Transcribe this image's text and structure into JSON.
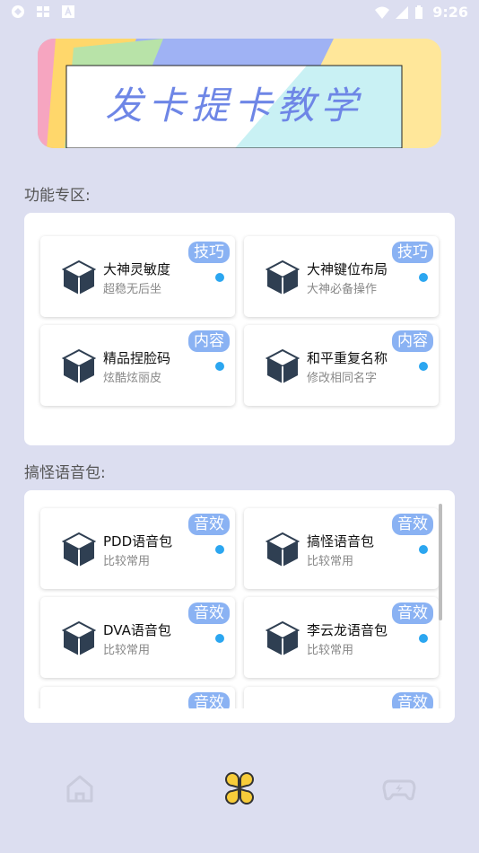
{
  "status_bar": {
    "time": "9:26"
  },
  "banner": {
    "title": "发卡提卡教学"
  },
  "sections": [
    {
      "label": "功能专区:",
      "cards": [
        {
          "title": "大神灵敏度",
          "subtitle": "超稳无后坐",
          "badge": "技巧"
        },
        {
          "title": "大神键位布局",
          "subtitle": "大神必备操作",
          "badge": "技巧"
        },
        {
          "title": "精品捏脸码",
          "subtitle": "炫酷炫丽皮",
          "badge": "内容"
        },
        {
          "title": "和平重复名称",
          "subtitle": "修改相同名字",
          "badge": "内容"
        }
      ]
    },
    {
      "label": "搞怪语音包:",
      "cards": [
        {
          "title": "PDD语音包",
          "subtitle": "比较常用",
          "badge": "音效"
        },
        {
          "title": "搞怪语音包",
          "subtitle": "比较常用",
          "badge": "音效"
        },
        {
          "title": "DVA语音包",
          "subtitle": "比较常用",
          "badge": "音效"
        },
        {
          "title": "李云龙语音包",
          "subtitle": "比较常用",
          "badge": "音效"
        },
        {
          "title": "",
          "subtitle": "",
          "badge": "音效"
        },
        {
          "title": "",
          "subtitle": "",
          "badge": "音效"
        }
      ]
    }
  ],
  "bottom_nav": [
    {
      "icon": "home-icon",
      "active": false
    },
    {
      "icon": "clover-icon",
      "active": true
    },
    {
      "icon": "gamepad-icon",
      "active": false
    }
  ],
  "colors": {
    "accent": "#8ab2f3",
    "dot": "#2ba6f0",
    "background": "#dcdef0",
    "active_nav": "#f7cc3a"
  }
}
